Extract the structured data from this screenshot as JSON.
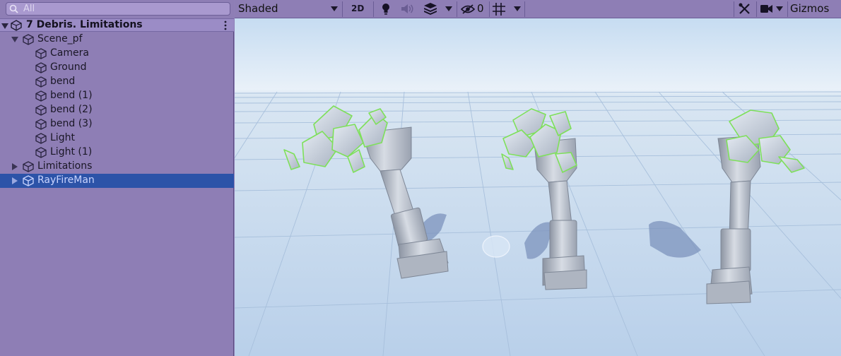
{
  "hierarchy": {
    "search_placeholder": "All",
    "scene_title": "7 Debris. Limitations",
    "items": [
      {
        "label": "Scene_pf"
      },
      {
        "label": "Camera"
      },
      {
        "label": "Ground"
      },
      {
        "label": "bend"
      },
      {
        "label": "bend (1)"
      },
      {
        "label": "bend (2)"
      },
      {
        "label": "bend (3)"
      },
      {
        "label": "Light"
      },
      {
        "label": "Light (1)"
      },
      {
        "label": "Limitations"
      },
      {
        "label": "RayFireMan"
      }
    ]
  },
  "toolbar": {
    "draw_mode": "Shaded",
    "mode_2d": "2D",
    "hidden_count": "0",
    "gizmos": "Gizmos"
  },
  "colors": {
    "panel_bg": "#8e7eb5",
    "selection": "#2c53a8",
    "collider_outline": "#7ee05a"
  }
}
